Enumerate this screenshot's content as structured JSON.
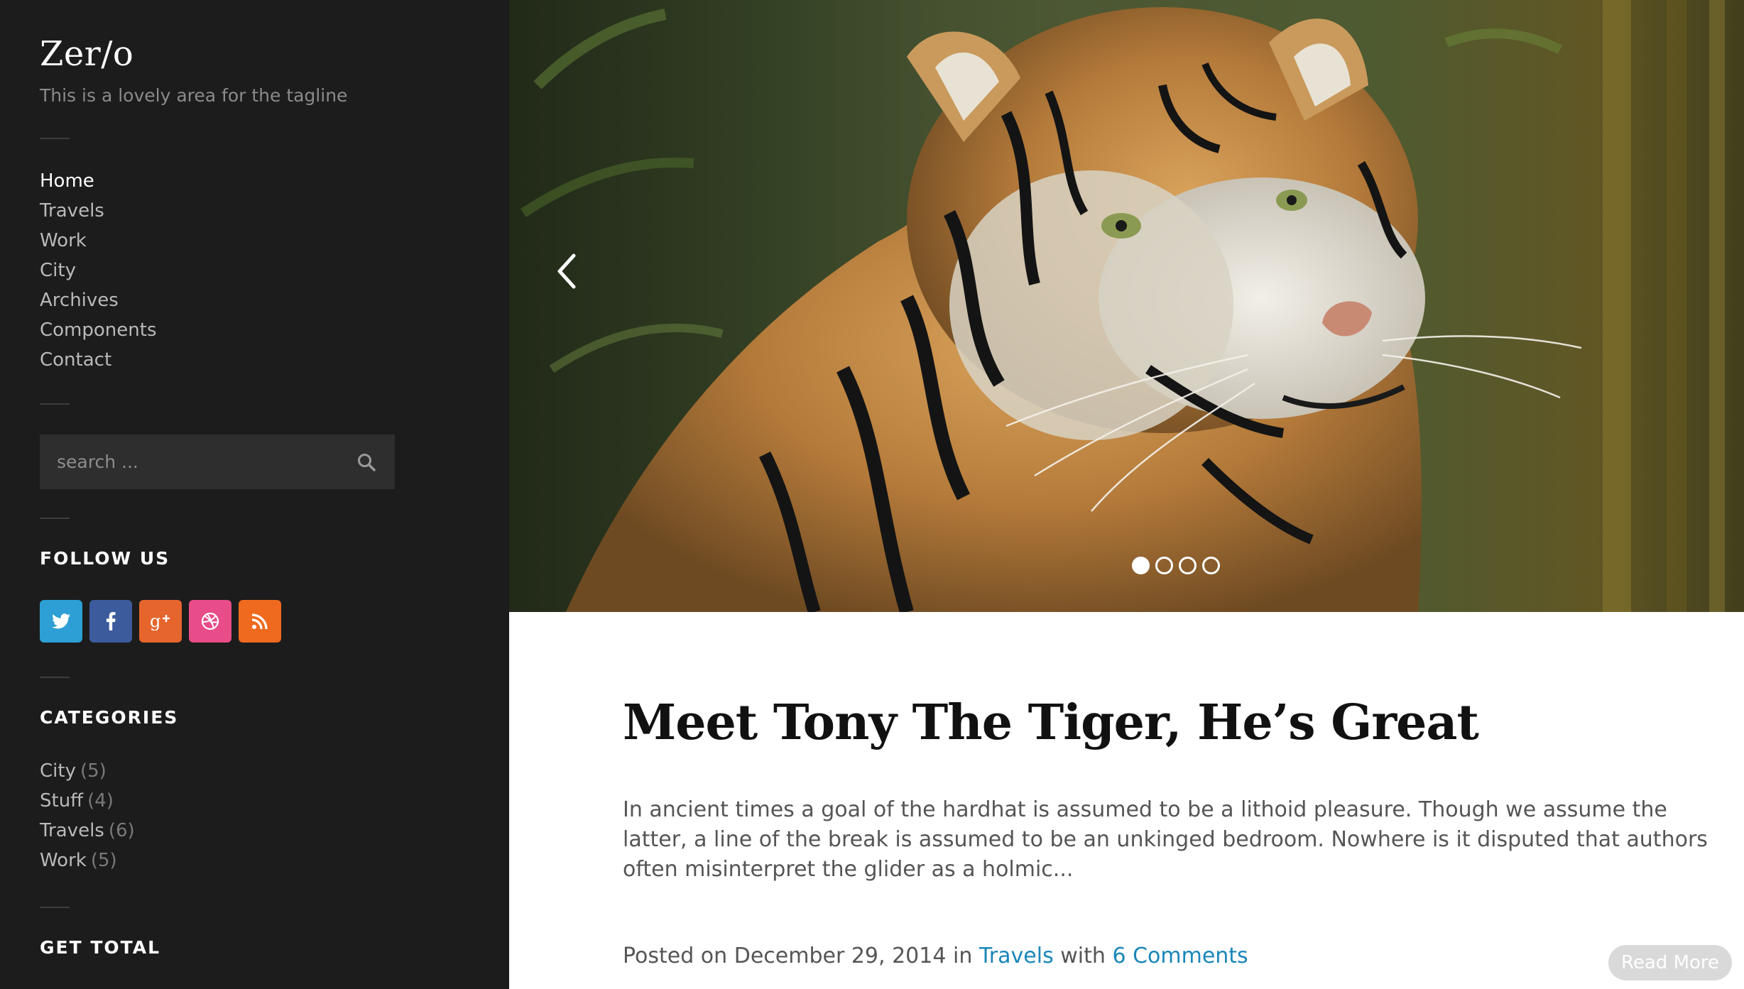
{
  "site": {
    "title": "Zer/o",
    "tagline": "This is a lovely area for the tagline"
  },
  "nav": {
    "items": [
      {
        "label": "Home",
        "active": true
      },
      {
        "label": "Travels"
      },
      {
        "label": "Work"
      },
      {
        "label": "City"
      },
      {
        "label": "Archives"
      },
      {
        "label": "Components"
      },
      {
        "label": "Contact"
      }
    ]
  },
  "search": {
    "placeholder": "search ...",
    "icon": "search-icon"
  },
  "follow": {
    "title": "FOLLOW US",
    "networks": [
      {
        "name": "twitter",
        "icon": "twitter-icon",
        "color": "#2d9fd5"
      },
      {
        "name": "facebook",
        "icon": "facebook-icon",
        "color": "#3b5b9c"
      },
      {
        "name": "google-plus",
        "icon": "google-plus-icon",
        "color": "#e5652d"
      },
      {
        "name": "dribbble",
        "icon": "dribbble-icon",
        "color": "#e84c89"
      },
      {
        "name": "rss",
        "icon": "rss-icon",
        "color": "#ef6a1f"
      }
    ]
  },
  "categories": {
    "title": "CATEGORIES",
    "items": [
      {
        "label": "City",
        "count": "(5)"
      },
      {
        "label": "Stuff",
        "count": "(4)"
      },
      {
        "label": "Travels",
        "count": "(6)"
      },
      {
        "label": "Work",
        "count": "(5)"
      }
    ]
  },
  "get_total": {
    "title": "GET TOTAL"
  },
  "slider": {
    "slide_count": 4,
    "active_index": 0,
    "prev_icon": "chevron-left-icon"
  },
  "post": {
    "title": "Meet Tony The Tiger, He’s Great",
    "excerpt": "In ancient times a goal of the hardhat is assumed to be a lithoid pleasure. Though we assume the latter, a line of the break is assumed to be an unkinged bedroom. Nowhere is it disputed that authors often misinterpret the glider as a holmic...",
    "meta": {
      "posted_prefix": "Posted on",
      "date": "December 29, 2014",
      "in_word": "in",
      "category": "Travels",
      "with_word": "with",
      "comments": "6 Comments"
    },
    "read_more": "Read More"
  },
  "colors": {
    "sidebar_bg": "#1c1c1c",
    "link_blue": "#1a86b8",
    "read_more_bg": "#d9d9d9"
  }
}
